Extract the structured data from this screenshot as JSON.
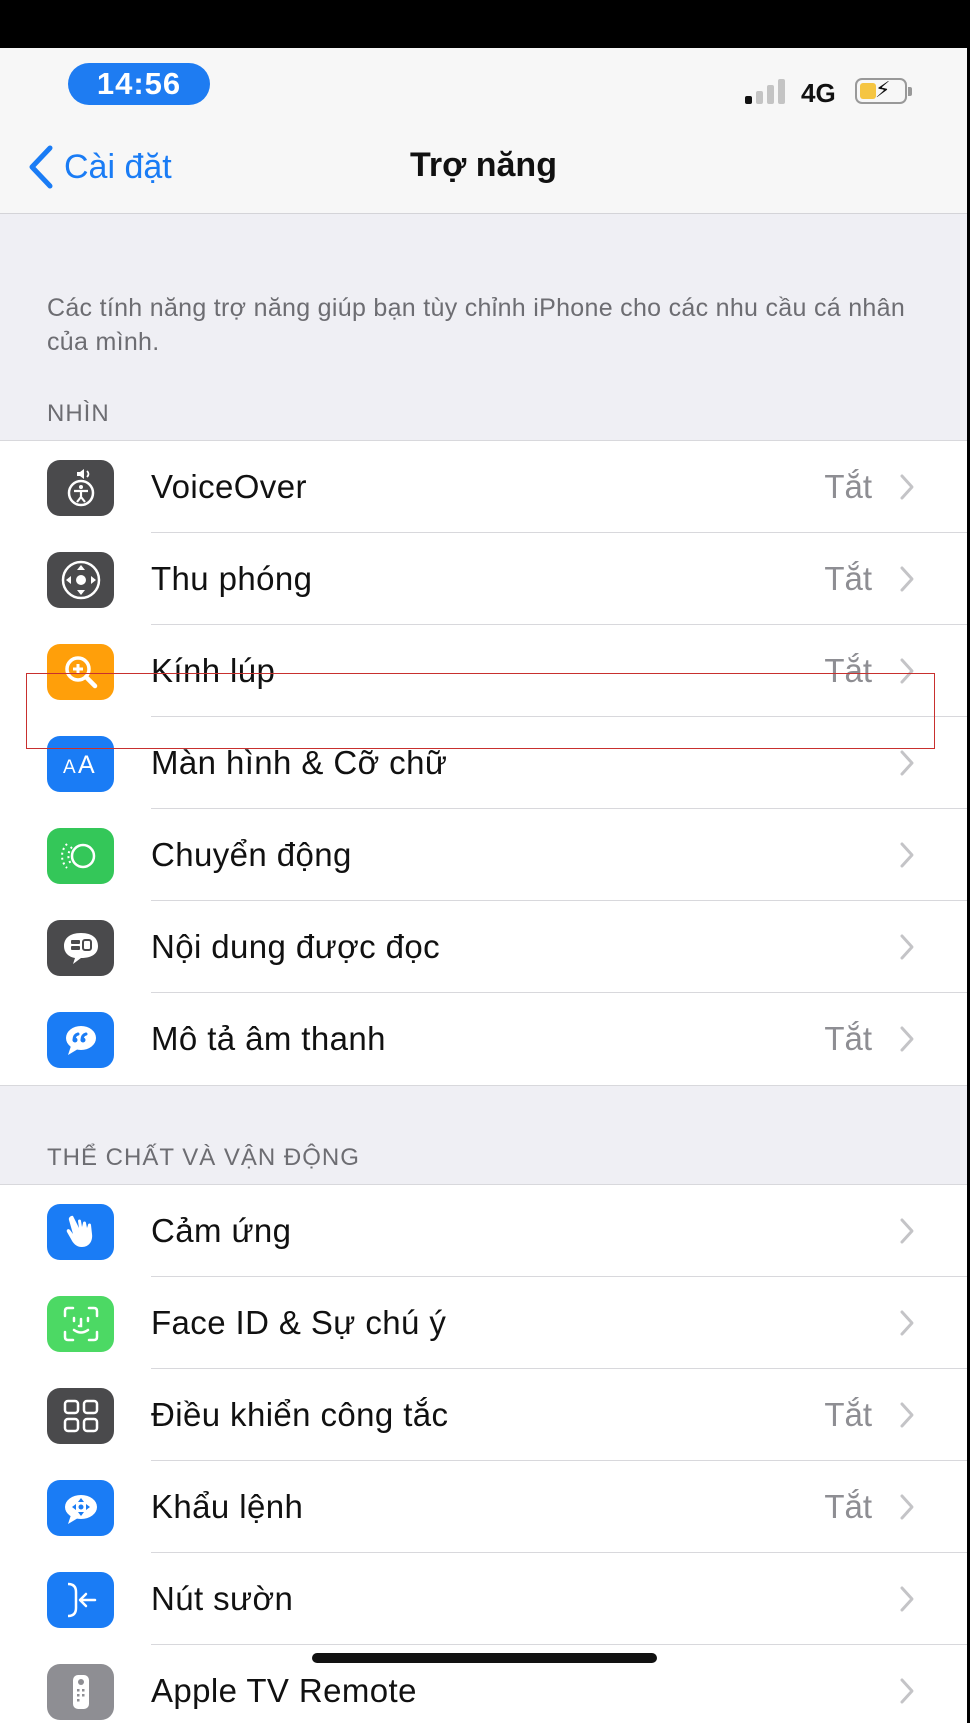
{
  "status_bar": {
    "time": "14:56",
    "network": "4G"
  },
  "nav": {
    "back_label": "Cài đặt",
    "title": "Trợ năng"
  },
  "intro": "Các tính năng trợ năng giúp bạn tùy chỉnh iPhone cho các nhu cầu cá nhân của mình.",
  "sections": [
    {
      "header": "NHÌN",
      "items": [
        {
          "label": "VoiceOver",
          "value": "Tắt",
          "icon": "voiceover-icon",
          "icon_color": "#4a4a4c"
        },
        {
          "label": "Thu phóng",
          "value": "Tắt",
          "icon": "zoom-icon",
          "icon_color": "#4a4a4c"
        },
        {
          "label": "Kính lúp",
          "value": "Tắt",
          "icon": "magnifier-icon",
          "icon_color": "#ff9f0a"
        },
        {
          "label": "Màn hình & Cỡ chữ",
          "value": "",
          "icon": "text-size-icon",
          "icon_color": "#1a7cf5",
          "highlighted": true
        },
        {
          "label": "Chuyển động",
          "value": "",
          "icon": "motion-icon",
          "icon_color": "#34c759"
        },
        {
          "label": "Nội dung được đọc",
          "value": "",
          "icon": "spoken-content-icon",
          "icon_color": "#4a4a4c"
        },
        {
          "label": "Mô tả âm thanh",
          "value": "Tắt",
          "icon": "audio-description-icon",
          "icon_color": "#1a7cf5"
        }
      ]
    },
    {
      "header": "THỂ CHẤT VÀ VẬN ĐỘNG",
      "items": [
        {
          "label": "Cảm ứng",
          "value": "",
          "icon": "touch-icon",
          "icon_color": "#1a7cf5"
        },
        {
          "label": "Face ID & Sự chú ý",
          "value": "",
          "icon": "face-id-icon",
          "icon_color": "#34c759"
        },
        {
          "label": "Điều khiển công tắc",
          "value": "Tắt",
          "icon": "switch-control-icon",
          "icon_color": "#4a4a4c"
        },
        {
          "label": "Khẩu lệnh",
          "value": "Tắt",
          "icon": "voice-control-icon",
          "icon_color": "#1a7cf5"
        },
        {
          "label": "Nút sườn",
          "value": "",
          "icon": "side-button-icon",
          "icon_color": "#1a7cf5"
        },
        {
          "label": "Apple TV Remote",
          "value": "",
          "icon": "remote-icon",
          "icon_color": "#8e8e93"
        }
      ]
    }
  ]
}
